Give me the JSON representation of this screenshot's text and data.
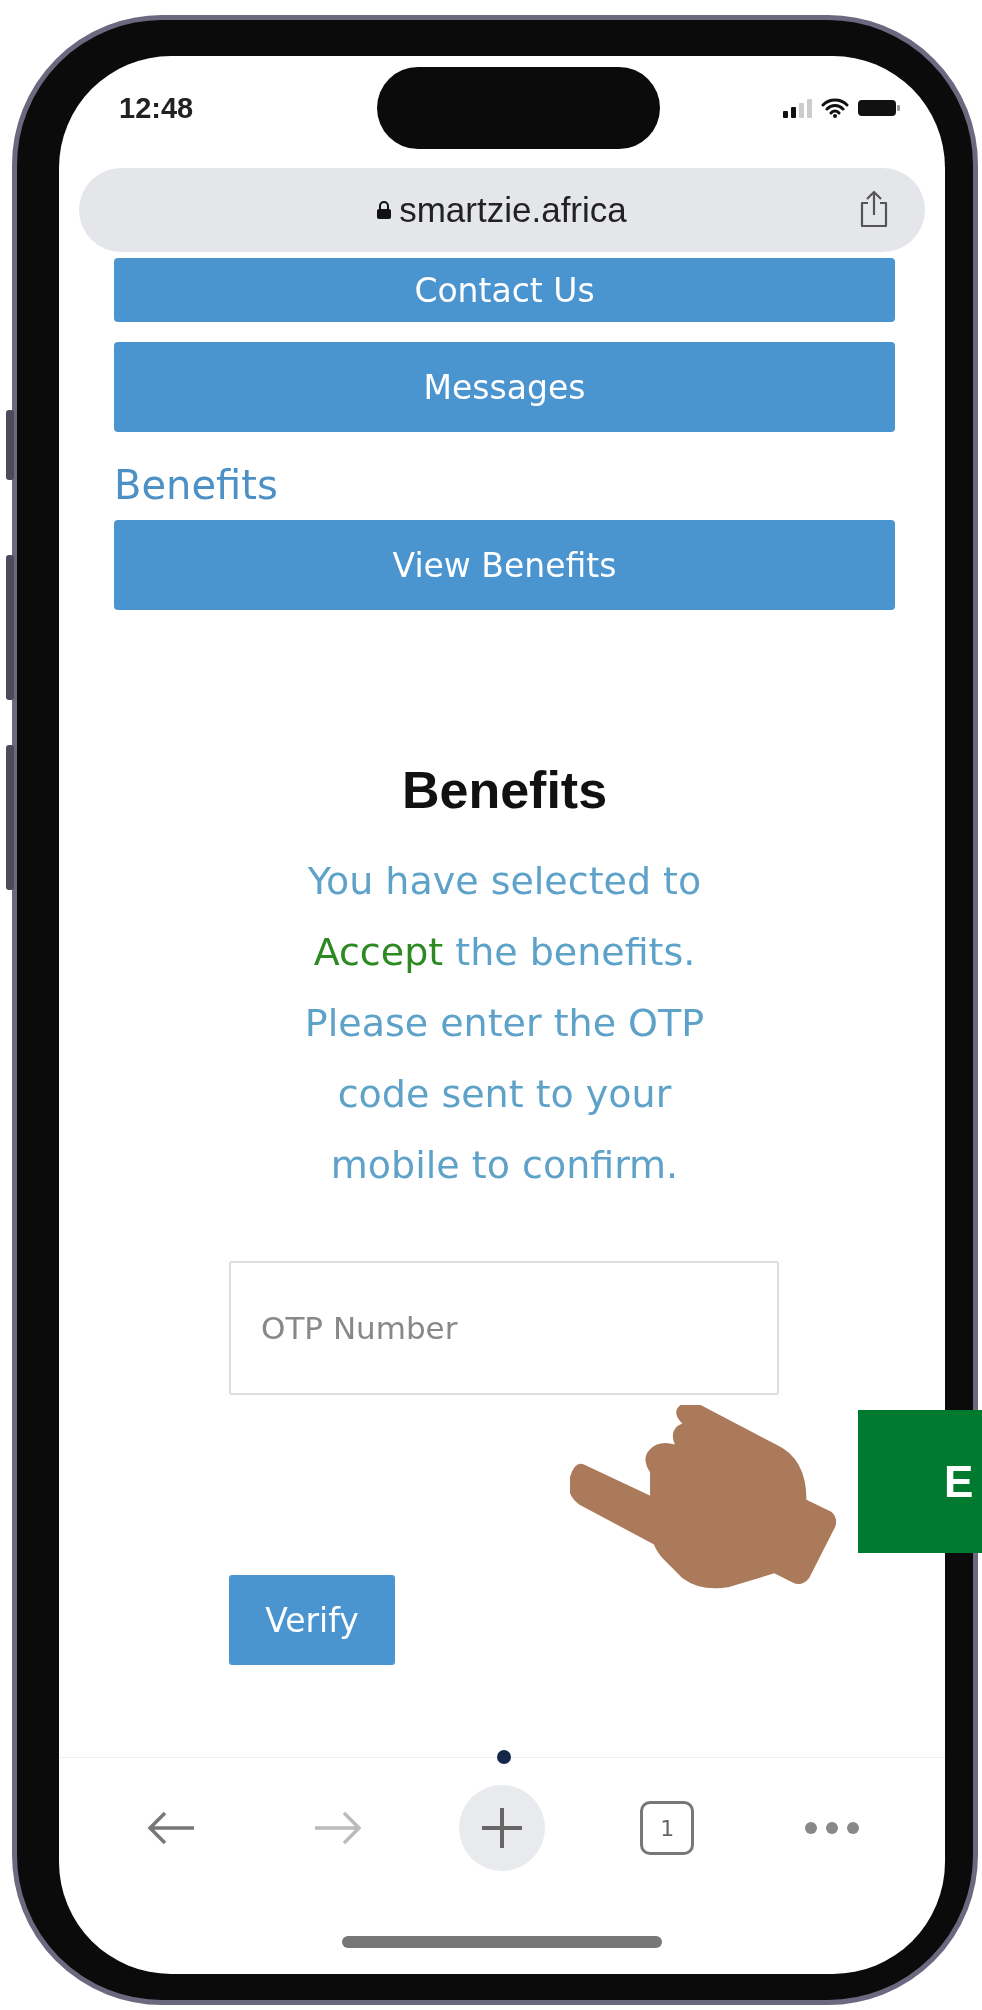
{
  "status_bar": {
    "time": "12:48"
  },
  "browser": {
    "url": "smartzie.africa"
  },
  "menu_buttons": [
    {
      "label": "Contact Us"
    },
    {
      "label": "Messages"
    }
  ],
  "section_label": "Benefits",
  "section_button": {
    "label": "View Benefits"
  },
  "dialog": {
    "title": "Benefits",
    "message_parts": [
      {
        "kind": "plain",
        "text": "You have selected to "
      },
      {
        "kind": "highlight",
        "text": "Accept"
      },
      {
        "kind": "plain",
        "text": " the benefits. Please enter the OTP code sent to your mobile to confirm."
      }
    ],
    "otp_field": {
      "placeholder": "OTP Number"
    },
    "verify_button": "Verify"
  },
  "callout": {
    "text": "E"
  },
  "toolbar": [
    {
      "kind": "back",
      "disabled": false
    },
    {
      "kind": "forward",
      "disabled": true
    },
    {
      "kind": "new-tab"
    },
    {
      "kind": "tabs",
      "label": "1"
    },
    {
      "kind": "more"
    }
  ]
}
